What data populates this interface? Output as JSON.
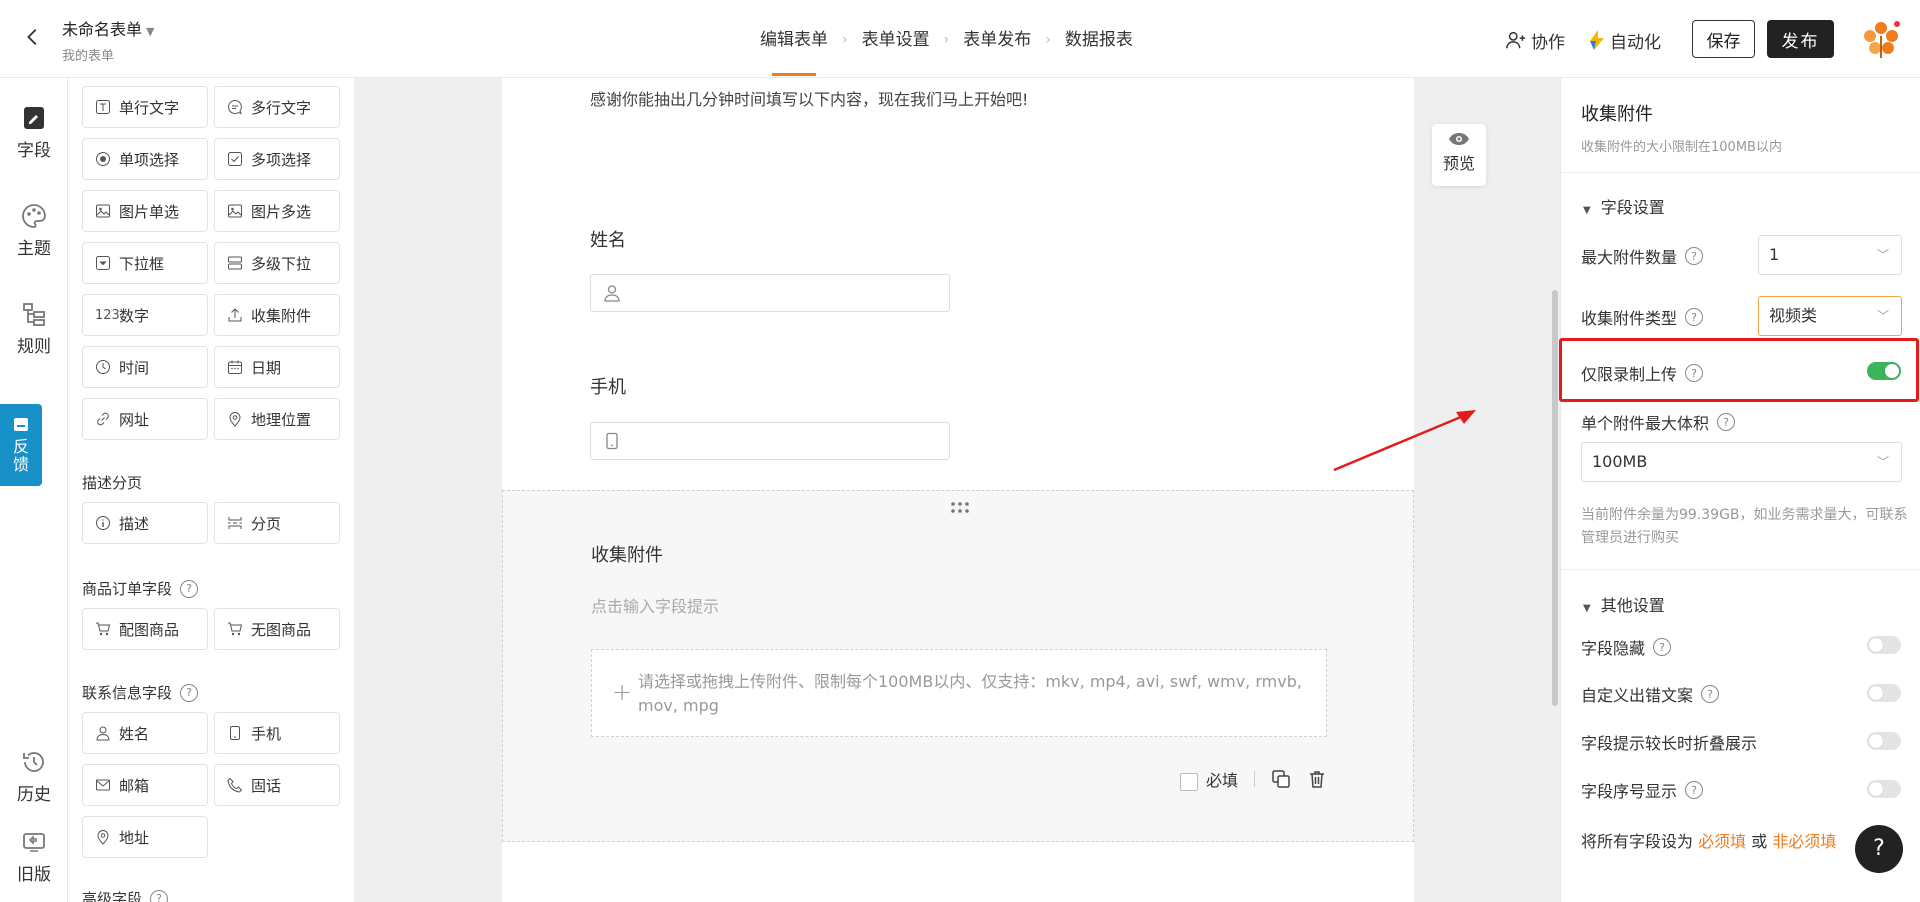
{
  "header": {
    "form_name": "未命名表单",
    "breadcrumb": "我的表单",
    "steps": [
      "编辑表单",
      "表单设置",
      "表单发布",
      "数据报表"
    ],
    "collab": "协作",
    "automation": "自动化",
    "save": "保存",
    "publish": "发布"
  },
  "rail": {
    "field": "字段",
    "theme": "主题",
    "rule": "规则",
    "feedback": "反馈",
    "history": "历史",
    "old": "旧版"
  },
  "fields": {
    "basic": [
      "单行文字",
      "多行文字",
      "单项选择",
      "多项选择",
      "图片单选",
      "图片多选",
      "下拉框",
      "多级下拉",
      "数字",
      "收集附件",
      "时间",
      "日期",
      "网址",
      "地理位置"
    ],
    "desc_section": "描述分页",
    "desc": [
      "描述",
      "分页"
    ],
    "order_section": "商品订单字段",
    "order": [
      "配图商品",
      "无图商品"
    ],
    "contact_section": "联系信息字段",
    "contact": [
      "姓名",
      "手机",
      "邮箱",
      "固话",
      "地址"
    ],
    "advanced_section": "高级字段"
  },
  "form": {
    "intro": "感谢你能抽出几分钟时间填写以下内容，现在我们马上开始吧!",
    "name_label": "姓名",
    "phone_label": "手机",
    "attach_label": "收集附件",
    "attach_hint": "点击输入字段提示",
    "upload_text": "请选择或拖拽上传附件、限制每个100MB以内、仅支持：mkv, mp4, avi, swf, wmv, rmvb, mov, mpg",
    "required": "必填",
    "preview": "预览"
  },
  "panel": {
    "title": "收集附件",
    "subtitle": "收集附件的大小限制在100MB以内",
    "field_settings": "字段设置",
    "max_count_label": "最大附件数量",
    "max_count_value": "1",
    "type_label": "收集附件类型",
    "type_value": "视频类",
    "record_only_label": "仅限录制上传",
    "max_size_label": "单个附件最大体积",
    "max_size_value": "100MB",
    "quota_note": "当前附件余量为99.39GB，如业务需求量大，可联系管理员进行购买",
    "other_settings": "其他设置",
    "hide_label": "字段隐藏",
    "custom_error_label": "自定义出错文案",
    "fold_label": "字段提示较长时折叠展示",
    "serial_label": "字段序号显示",
    "bulk_prefix": "将所有字段设为",
    "bulk_required": "必须填",
    "bulk_or": "或",
    "bulk_optional": "非必须填",
    "help": "?"
  },
  "colors": {
    "accent": "#f07c1c",
    "toggle_on": "#3cb45a",
    "rail_active": "#1890c8",
    "highlight": "#e31b1b"
  },
  "toggles": {
    "record_only": true,
    "hide": false,
    "custom_error": false,
    "fold": false,
    "serial": false
  }
}
